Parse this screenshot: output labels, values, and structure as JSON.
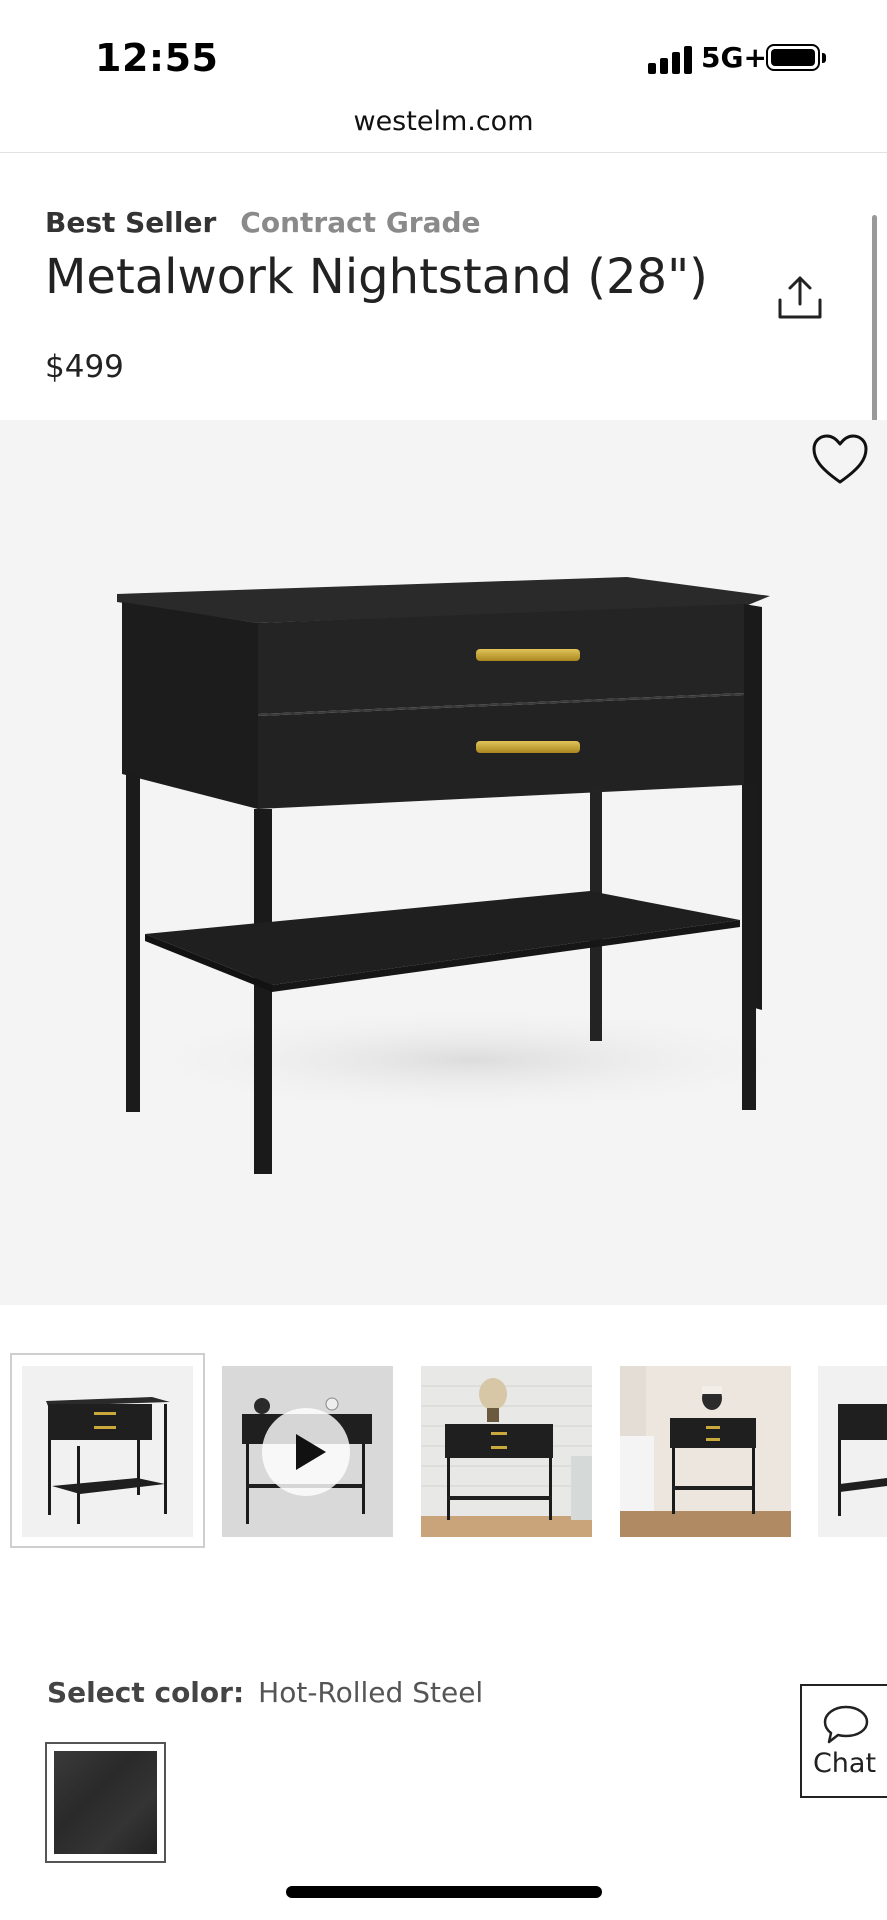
{
  "status_bar": {
    "time": "12:55",
    "network": "5G+",
    "icons": [
      "signal-icon",
      "battery-icon"
    ]
  },
  "browser": {
    "url": "westelm.com"
  },
  "product": {
    "badges": {
      "best_seller": "Best Seller",
      "contract_grade": "Contract Grade"
    },
    "title": "Metalwork Nightstand (28\")",
    "price": "$499",
    "icons": [
      "share-icon",
      "heart-icon"
    ]
  },
  "gallery": {
    "thumbnails": [
      {
        "name": "studio-front",
        "selected": true
      },
      {
        "name": "video",
        "selected": false
      },
      {
        "name": "brick-wall-room",
        "selected": false
      },
      {
        "name": "bedroom",
        "selected": false
      },
      {
        "name": "studio-partial",
        "selected": false
      }
    ],
    "icons": [
      "play-icon"
    ]
  },
  "color_select": {
    "label": "Select color:",
    "value": "Hot-Rolled Steel"
  },
  "chat": {
    "label": "Chat",
    "icon": "chat-icon"
  },
  "colors": {
    "accent_text": "#222222",
    "muted": "#8a8a8a",
    "hardware_brass": "#c9a83c",
    "furniture_black": "#1e1e1f"
  }
}
